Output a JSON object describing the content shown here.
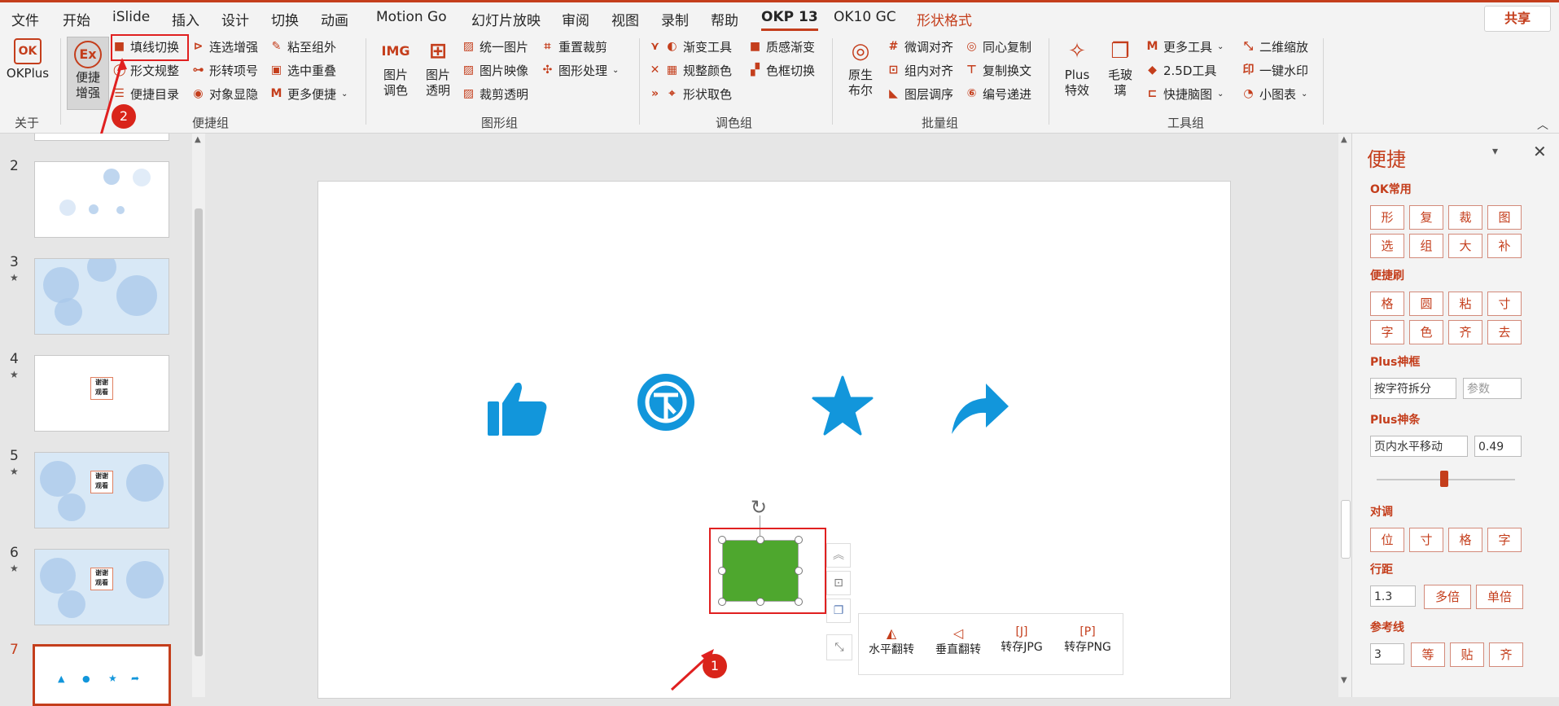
{
  "menu": {
    "tabs": [
      "文件",
      "开始",
      "iSlide",
      "插入",
      "设计",
      "切换",
      "动画",
      "Motion Go",
      "幻灯片放映",
      "审阅",
      "视图",
      "录制",
      "帮助",
      "OKP 13",
      "OK10 GC",
      "形状格式"
    ],
    "share": "共享"
  },
  "ribbon": {
    "okplus": {
      "label": "OKPlus",
      "group": "关于"
    },
    "convenience": {
      "big_label": "便捷增强",
      "items": [
        "填线切换",
        "形文规整",
        "便捷目录",
        "连选增强",
        "形转项号",
        "对象显隐",
        "粘至组外",
        "选中重叠",
        "更多便捷"
      ],
      "group": "便捷组"
    },
    "graphics": {
      "big1": "图片调色",
      "big2": "图片透明",
      "items": [
        "统一图片",
        "图片映像",
        "裁剪透明",
        "重置裁剪",
        "图形处理"
      ],
      "group": "图形组"
    },
    "color": {
      "items": [
        "渐变工具",
        "规整颜色",
        "形状取色",
        "质感渐变",
        "色框切换"
      ],
      "group": "调色组"
    },
    "batch": {
      "big": "原生布尔",
      "items": [
        "微调对齐",
        "组内对齐",
        "图层调序",
        "同心复制",
        "复制换文",
        "编号递进"
      ],
      "group": "批量组"
    },
    "tools": {
      "big1": "Plus特效",
      "big2": "毛玻璃",
      "items": [
        "更多工具",
        "2.5D工具",
        "快捷脑图",
        "二维缩放",
        "一键水印",
        "小图表"
      ],
      "group": "工具组"
    }
  },
  "slides": [
    {
      "num": "2",
      "star": ""
    },
    {
      "num": "3",
      "star": "★"
    },
    {
      "num": "4",
      "star": "★"
    },
    {
      "num": "5",
      "star": "★"
    },
    {
      "num": "6",
      "star": "★"
    },
    {
      "num": "7",
      "star": ""
    }
  ],
  "thumb_text": "谢谢\n观看",
  "floating_toolbar": [
    "水平翻转",
    "垂直翻转",
    "转存JPG",
    "转存PNG"
  ],
  "pane": {
    "title": "便捷",
    "ok_common": {
      "label": "OK常用",
      "buttons": [
        "形",
        "复",
        "裁",
        "图",
        "选",
        "组",
        "大",
        "补"
      ]
    },
    "brush": {
      "label": "便捷刷",
      "buttons": [
        "格",
        "圆",
        "粘",
        "寸",
        "字",
        "色",
        "齐",
        "去"
      ]
    },
    "plus_frame": {
      "label": "Plus神框",
      "value": "按字符拆分",
      "param_placeholder": "参数"
    },
    "plus_bar": {
      "label": "Plus神条",
      "mode": "页内水平移动",
      "value": "0.49",
      "slider": 0.49
    },
    "align": {
      "label": "对调",
      "buttons": [
        "位",
        "寸",
        "格",
        "字"
      ]
    },
    "spacing": {
      "label": "行距",
      "value": "1.3",
      "buttons": [
        "多倍",
        "单倍"
      ]
    },
    "guide": {
      "label": "参考线",
      "value": "3",
      "buttons": [
        "等",
        "贴",
        "齐"
      ]
    }
  },
  "annotations": {
    "badge1": "1",
    "badge2": "2"
  },
  "colors": {
    "accent": "#c43e1c",
    "icon_blue": "#1296db",
    "shape_green": "#4ea72e",
    "marker_red": "#e02020"
  }
}
